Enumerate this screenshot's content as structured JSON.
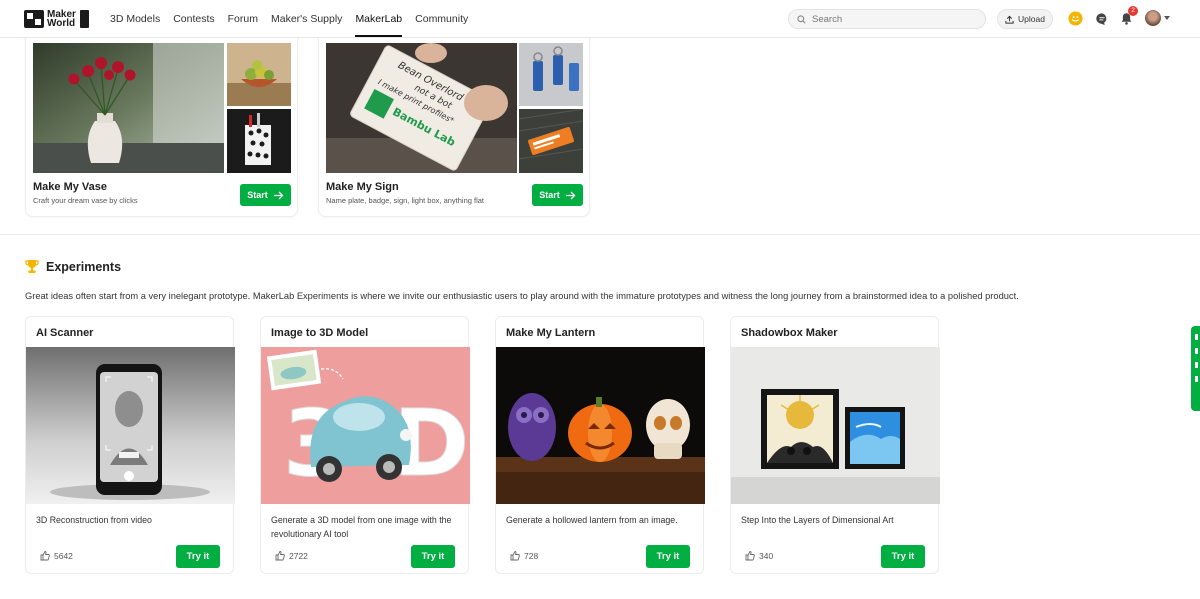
{
  "header": {
    "logo_text": "Maker World",
    "nav": [
      "3D Models",
      "Contests",
      "Forum",
      "Maker's Supply",
      "MakerLab",
      "Community"
    ],
    "active_nav": "MakerLab",
    "search_placeholder": "Search",
    "upload_label": "Upload",
    "notification_count": "2"
  },
  "top_cards": [
    {
      "title": "Make My Vase",
      "subtitle": "Craft your dream vase by clicks",
      "button": "Start"
    },
    {
      "title": "Make My Sign",
      "subtitle": "Name plate, badge, sign, light box, anything flat",
      "button": "Start"
    }
  ],
  "sign_card_text": {
    "line1": "Bean Overlord",
    "line2": "not a bot",
    "line3": "I make print profiles*",
    "brand": "Bambu Lab"
  },
  "experiments": {
    "title": "Experiments",
    "description": "Great ideas often start from a very inelegant prototype. MakerLab Experiments is where we invite our enthusiastic users to play around with the immature prototypes and witness the long journey from a brainstormed idea to a polished product.",
    "cards": [
      {
        "title": "AI Scanner",
        "description": "3D Reconstruction from video",
        "likes": "5642",
        "button": "Try it"
      },
      {
        "title": "Image to 3D Model",
        "description": "Generate a 3D model from one image with the revolutionary AI tool",
        "likes": "2722",
        "button": "Try it"
      },
      {
        "title": "Make My Lantern",
        "description": "Generate a hollowed lantern from an image.",
        "likes": "728",
        "button": "Try it"
      },
      {
        "title": "Shadowbox Maker",
        "description": "Step Into the Layers of Dimensional Art",
        "likes": "340",
        "button": "Try it"
      }
    ]
  },
  "colors": {
    "accent": "#00ae42",
    "badge": "#e53935",
    "trophy": "#f5b400"
  }
}
